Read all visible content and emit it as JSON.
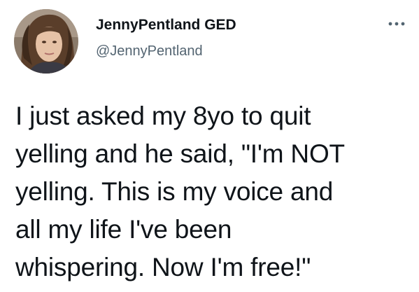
{
  "tweet": {
    "author": {
      "display_name": "JennyPentland GED",
      "handle": "@JennyPentland",
      "avatar_icon": "profile-photo"
    },
    "more_icon": "more-options-icon",
    "lines": [
      "I just asked my 8yo to quit",
      "yelling and he said, \"I'm NOT",
      "yelling. This is my voice and",
      "all my life I've been",
      "whispering. Now I'm free!\""
    ]
  }
}
